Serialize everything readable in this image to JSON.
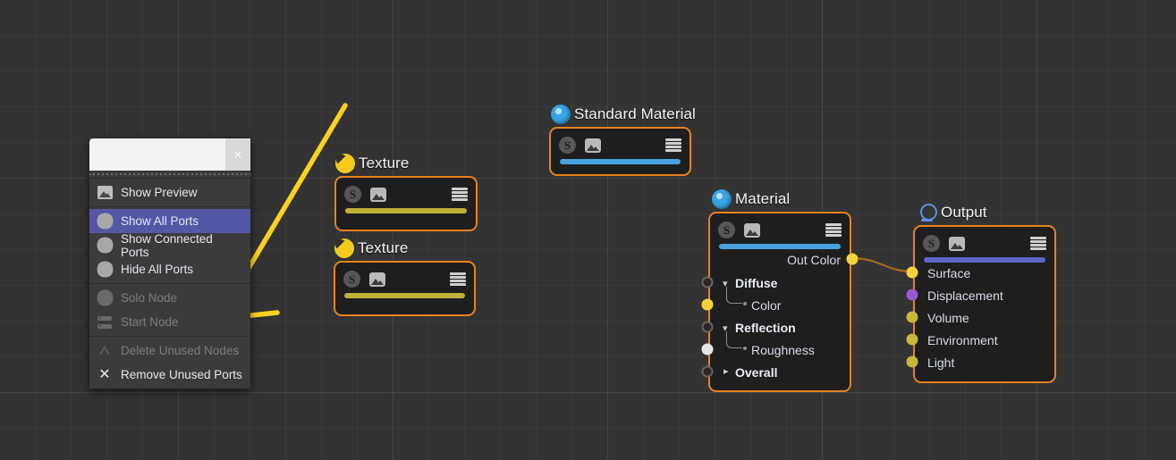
{
  "app": {
    "canvas_background": "#333333",
    "grid_spacing_px": 40
  },
  "context_menu": {
    "close_label": "×",
    "groups": [
      {
        "items": [
          {
            "label": "Show Preview",
            "icon": "image-preview-icon",
            "state": "enabled",
            "selected": false
          }
        ]
      },
      {
        "items": [
          {
            "label": "Show All Ports",
            "icon": "gear-icon",
            "state": "enabled",
            "selected": true
          },
          {
            "label": "Show Connected Ports",
            "icon": "gear-icon",
            "state": "enabled",
            "selected": false
          },
          {
            "label": "Hide All Ports",
            "icon": "gear-icon",
            "state": "enabled",
            "selected": false
          }
        ]
      },
      {
        "items": [
          {
            "label": "Solo Node",
            "icon": "gear-icon",
            "state": "disabled",
            "selected": false
          },
          {
            "label": "Start Node",
            "icon": "start-node-icon",
            "state": "disabled",
            "selected": false
          }
        ]
      },
      {
        "items": [
          {
            "label": "Delete Unused Nodes",
            "icon": "delete-triangle-icon",
            "state": "disabled",
            "selected": false
          },
          {
            "label": "Remove Unused Ports",
            "icon": "close-x-icon",
            "state": "enabled",
            "selected": false
          }
        ]
      }
    ],
    "highlight_color": "#5457a6"
  },
  "nodes": {
    "texture1": {
      "title": "Texture",
      "title_icon": "yellow-sphere-icon",
      "bar_color": "#bfb03a",
      "border_color": "#e8821e",
      "header_icons": [
        "s-badge-icon",
        "image-icon",
        "hamburger-icon"
      ]
    },
    "texture2": {
      "title": "Texture",
      "title_icon": "yellow-sphere-icon",
      "bar_color": "#bfb03a",
      "border_color": "#e8821e",
      "header_icons": [
        "s-badge-icon",
        "image-icon",
        "hamburger-icon"
      ]
    },
    "standard_material": {
      "title": "Standard Material",
      "title_icon": "blue-sphere-icon",
      "bar_color": "#4aa3dc",
      "border_color": "#e8821e",
      "header_icons": [
        "s-badge-icon",
        "image-icon",
        "hamburger-icon"
      ]
    },
    "material": {
      "title": "Material",
      "title_icon": "blue-sphere-icon",
      "bar_color": "#4aa3dc",
      "border_color": "#e8821e",
      "header_icons": [
        "s-badge-icon",
        "image-icon",
        "hamburger-icon"
      ],
      "output_ports": [
        {
          "label": "Out Color",
          "color": "#f5d33c"
        }
      ],
      "input_rows": [
        {
          "label": "Diffuse",
          "kind": "group",
          "expanded": true,
          "caret": "˅",
          "port_color": "hollow"
        },
        {
          "label": "Color",
          "kind": "child",
          "port_color": "#f0d13a"
        },
        {
          "label": "Reflection",
          "kind": "group",
          "expanded": true,
          "caret": "˅",
          "port_color": "hollow"
        },
        {
          "label": "Roughness",
          "kind": "child",
          "port_color": "#e6e6e6"
        },
        {
          "label": "Overall",
          "kind": "group",
          "expanded": false,
          "caret": "›",
          "port_color": "hollow"
        }
      ]
    },
    "output": {
      "title": "Output",
      "title_icon": "output-ring-icon",
      "bar_color": "#6066c8",
      "border_color": "#e8821e",
      "header_icons": [
        "s-badge-icon",
        "image-icon",
        "hamburger-icon"
      ],
      "input_ports": [
        {
          "label": "Surface",
          "color": "#f5d33c"
        },
        {
          "label": "Displacement",
          "color": "#9b59d0"
        },
        {
          "label": "Volume",
          "color": "#c9b83c"
        },
        {
          "label": "Environment",
          "color": "#c9b83c"
        },
        {
          "label": "Light",
          "color": "#c9b83c"
        }
      ]
    }
  },
  "connections": [
    {
      "from": "material.Out Color",
      "to": "output.Surface",
      "color": "#a36a1e"
    }
  ],
  "annotation": {
    "type": "arrow",
    "color": "#ffd21e"
  }
}
